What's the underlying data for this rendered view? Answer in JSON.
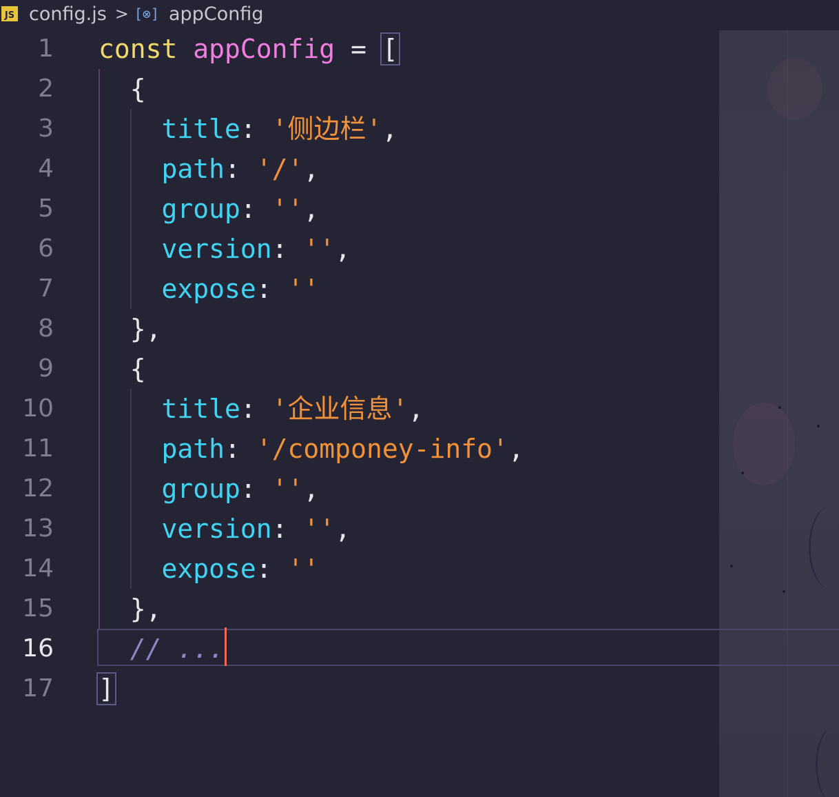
{
  "breadcrumb": {
    "file_icon": "JS",
    "file_name": "config.js",
    "separator": ">",
    "symbol_icon": "[⊗]",
    "symbol_name": "appConfig"
  },
  "editor": {
    "active_line": 16,
    "lines": [
      {
        "number": "1",
        "tokens": [
          {
            "t": "kw",
            "v": "const"
          },
          {
            "t": "punc",
            "v": " "
          },
          {
            "t": "var",
            "v": "appConfig"
          },
          {
            "t": "punc",
            "v": " = "
          },
          {
            "t": "bracket",
            "v": "["
          }
        ]
      },
      {
        "number": "2",
        "tokens": [
          {
            "t": "punc",
            "v": "  {"
          }
        ]
      },
      {
        "number": "3",
        "tokens": [
          {
            "t": "punc",
            "v": "    "
          },
          {
            "t": "prop",
            "v": "title"
          },
          {
            "t": "punc",
            "v": ": "
          },
          {
            "t": "str",
            "v": "'侧边栏'"
          },
          {
            "t": "punc",
            "v": ","
          }
        ]
      },
      {
        "number": "4",
        "tokens": [
          {
            "t": "punc",
            "v": "    "
          },
          {
            "t": "prop",
            "v": "path"
          },
          {
            "t": "punc",
            "v": ": "
          },
          {
            "t": "str",
            "v": "'/'"
          },
          {
            "t": "punc",
            "v": ","
          }
        ]
      },
      {
        "number": "5",
        "tokens": [
          {
            "t": "punc",
            "v": "    "
          },
          {
            "t": "prop",
            "v": "group"
          },
          {
            "t": "punc",
            "v": ": "
          },
          {
            "t": "str",
            "v": "''"
          },
          {
            "t": "punc",
            "v": ","
          }
        ]
      },
      {
        "number": "6",
        "tokens": [
          {
            "t": "punc",
            "v": "    "
          },
          {
            "t": "prop",
            "v": "version"
          },
          {
            "t": "punc",
            "v": ": "
          },
          {
            "t": "str",
            "v": "''"
          },
          {
            "t": "punc",
            "v": ","
          }
        ]
      },
      {
        "number": "7",
        "tokens": [
          {
            "t": "punc",
            "v": "    "
          },
          {
            "t": "prop",
            "v": "expose"
          },
          {
            "t": "punc",
            "v": ": "
          },
          {
            "t": "str",
            "v": "''"
          }
        ]
      },
      {
        "number": "8",
        "tokens": [
          {
            "t": "punc",
            "v": "  },"
          }
        ]
      },
      {
        "number": "9",
        "tokens": [
          {
            "t": "punc",
            "v": "  {"
          }
        ]
      },
      {
        "number": "10",
        "tokens": [
          {
            "t": "punc",
            "v": "    "
          },
          {
            "t": "prop",
            "v": "title"
          },
          {
            "t": "punc",
            "v": ": "
          },
          {
            "t": "str",
            "v": "'企业信息'"
          },
          {
            "t": "punc",
            "v": ","
          }
        ]
      },
      {
        "number": "11",
        "tokens": [
          {
            "t": "punc",
            "v": "    "
          },
          {
            "t": "prop",
            "v": "path"
          },
          {
            "t": "punc",
            "v": ": "
          },
          {
            "t": "str",
            "v": "'/componey-info'"
          },
          {
            "t": "punc",
            "v": ","
          }
        ]
      },
      {
        "number": "12",
        "tokens": [
          {
            "t": "punc",
            "v": "    "
          },
          {
            "t": "prop",
            "v": "group"
          },
          {
            "t": "punc",
            "v": ": "
          },
          {
            "t": "str",
            "v": "''"
          },
          {
            "t": "punc",
            "v": ","
          }
        ]
      },
      {
        "number": "13",
        "tokens": [
          {
            "t": "punc",
            "v": "    "
          },
          {
            "t": "prop",
            "v": "version"
          },
          {
            "t": "punc",
            "v": ": "
          },
          {
            "t": "str",
            "v": "''"
          },
          {
            "t": "punc",
            "v": ","
          }
        ]
      },
      {
        "number": "14",
        "tokens": [
          {
            "t": "punc",
            "v": "    "
          },
          {
            "t": "prop",
            "v": "expose"
          },
          {
            "t": "punc",
            "v": ": "
          },
          {
            "t": "str",
            "v": "''"
          }
        ]
      },
      {
        "number": "15",
        "tokens": [
          {
            "t": "punc",
            "v": "  },"
          }
        ]
      },
      {
        "number": "16",
        "tokens": [
          {
            "t": "punc",
            "v": "  "
          },
          {
            "t": "cmt",
            "v": "// ..."
          },
          {
            "t": "cursor",
            "v": ""
          }
        ]
      },
      {
        "number": "17",
        "tokens": [
          {
            "t": "bracket",
            "v": "]"
          }
        ]
      }
    ]
  },
  "colors": {
    "background": "#252434",
    "keyword": "#f0d96a",
    "variable": "#f27de1",
    "property": "#41d3f2",
    "string": "#f1923a",
    "comment": "#8a86c7",
    "cursor": "#f06a5a"
  }
}
